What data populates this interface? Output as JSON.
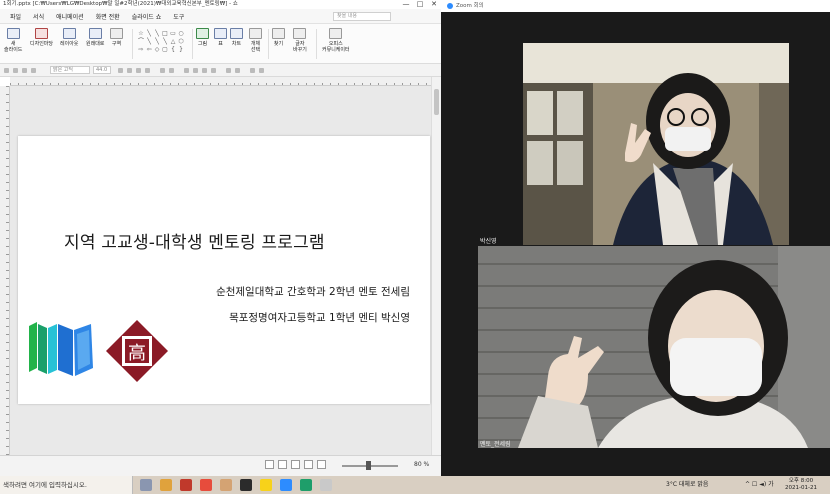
{
  "editor": {
    "title": "1회기.pptx [C:₩Users₩LG₩Desktop₩말 일#2학년(2021)₩대외교육혁신본부_멘토링₩] - 쇼",
    "controls": [
      "—",
      "□",
      "✕"
    ],
    "menus": [
      "파일",
      "서식",
      "애니메이션",
      "화면 전환",
      "슬라이드 쇼",
      "도구"
    ],
    "search_placeholder": "찾을 내용",
    "ribbon": {
      "new_slide": "새\n슬라이드",
      "design": "디자인마당",
      "layout": "레이아웃",
      "outline": "원래대로",
      "section": "구역",
      "image": "그림",
      "table": "표",
      "chart": "차트",
      "object": "개체\n선택",
      "find": "찾기",
      "format_painter": "글자\n바꾸기",
      "office_community": "오피스\n커뮤니케이터"
    },
    "font": "맑은 고딕",
    "font_size": "44.0",
    "zoom_level": "80 %"
  },
  "slide": {
    "title": "지역 고교생-대학생 멘토링 프로그램",
    "line1": "순천제일대학교 간호학과 2학년 멘토 전세림",
    "line2": "목포정명여자고등학교 1학년 멘티 박신영",
    "seal_char": "高"
  },
  "meeting": {
    "title": "Zoom 회의",
    "participants": [
      {
        "name": "박신영"
      },
      {
        "name": "멘토_전세림"
      }
    ]
  },
  "taskbar": {
    "search_text": "색하려면 여기에 입력하십시오.",
    "weather": "3°C  대체로 맑음",
    "tray": "^ ☐ ◄) 가",
    "time": "오후 8:00",
    "date": "2021-01-21"
  },
  "colors": {
    "zoom_blue": "#2d8cff",
    "seal_red": "#8b1a26",
    "book_blue": "#1f6fd1",
    "book_green": "#22b34a"
  }
}
